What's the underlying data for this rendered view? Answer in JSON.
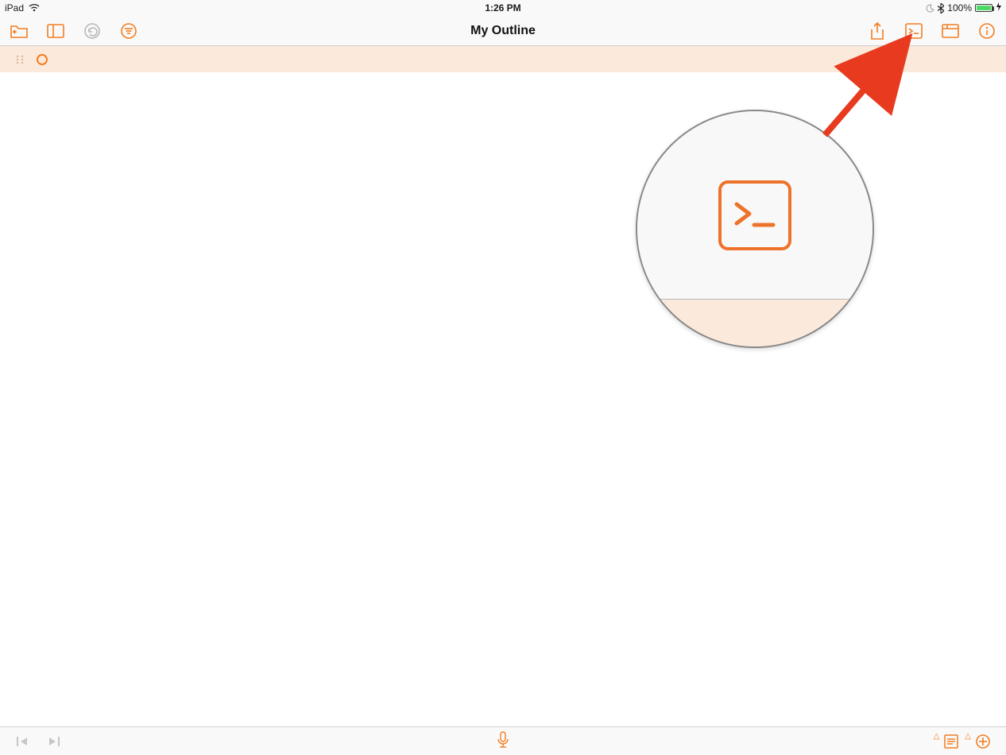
{
  "status": {
    "device": "iPad",
    "time": "1:26 PM",
    "battery_pct": "100%"
  },
  "toolbar": {
    "title": "My Outline"
  },
  "icons": {
    "documents": "documents-icon",
    "sidebar": "sidebar-icon",
    "undo": "undo-icon",
    "filter": "filter-icon",
    "share": "share-icon",
    "scripts": "scripts-icon",
    "columns": "columns-icon",
    "info": "info-icon"
  },
  "bottom": {
    "mic": "microphone-icon"
  },
  "callout_for": "scripts-button"
}
